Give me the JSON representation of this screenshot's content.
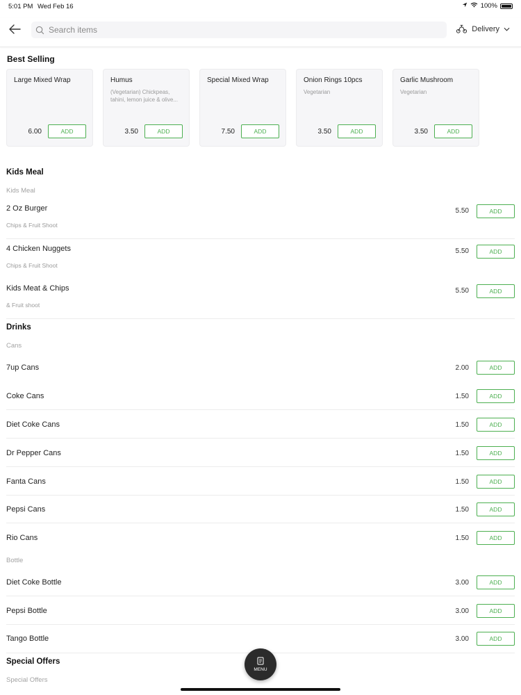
{
  "status": {
    "time": "5:01 PM",
    "date": "Wed Feb 16",
    "battery": "100%"
  },
  "header": {
    "search_placeholder": "Search items",
    "delivery_label": "Delivery"
  },
  "best_selling": {
    "title": "Best Selling",
    "items": [
      {
        "name": "Large Mixed Wrap",
        "desc": "",
        "price": "6.00",
        "add": "ADD"
      },
      {
        "name": "Humus",
        "desc": "(Vegetarian) Chickpeas, tahini, lemon juice & olive...",
        "price": "3.50",
        "add": "ADD"
      },
      {
        "name": "Special Mixed Wrap",
        "desc": "",
        "price": "7.50",
        "add": "ADD"
      },
      {
        "name": "Onion Rings 10pcs",
        "desc": "Vegetarian",
        "price": "3.50",
        "add": "ADD"
      },
      {
        "name": "Garlic Mushroom",
        "desc": "Vegetarian",
        "price": "3.50",
        "add": "ADD"
      }
    ]
  },
  "kids_meal": {
    "title": "Kids Meal",
    "subtitle": "Kids Meal",
    "items": [
      {
        "name": "2 Oz Burger",
        "desc": "Chips & Fruit Shoot",
        "price": "5.50",
        "add": "ADD"
      },
      {
        "name": "4 Chicken Nuggets",
        "desc": "Chips & Fruit Shoot",
        "price": "5.50",
        "add": "ADD"
      },
      {
        "name": "Kids Meat & Chips",
        "desc": "& Fruit shoot",
        "price": "5.50",
        "add": "ADD"
      }
    ]
  },
  "drinks": {
    "title": "Drinks",
    "cans_subtitle": "Cans",
    "cans": [
      {
        "name": "7up Cans",
        "price": "2.00",
        "add": "ADD"
      },
      {
        "name": "Coke Cans",
        "price": "1.50",
        "add": "ADD"
      },
      {
        "name": "Diet Coke Cans",
        "price": "1.50",
        "add": "ADD"
      },
      {
        "name": "Dr Pepper Cans",
        "price": "1.50",
        "add": "ADD"
      },
      {
        "name": "Fanta Cans",
        "price": "1.50",
        "add": "ADD"
      },
      {
        "name": "Pepsi Cans",
        "price": "1.50",
        "add": "ADD"
      },
      {
        "name": "Rio Cans",
        "price": "1.50",
        "add": "ADD"
      }
    ],
    "bottle_subtitle": "Bottle",
    "bottles": [
      {
        "name": "Diet Coke Bottle",
        "price": "3.00",
        "add": "ADD"
      },
      {
        "name": "Pepsi Bottle",
        "price": "3.00",
        "add": "ADD"
      },
      {
        "name": "Tango Bottle",
        "price": "3.00",
        "add": "ADD"
      }
    ]
  },
  "special_offers": {
    "title": "Special Offers",
    "subtitle": "Special Offers"
  },
  "menu_fab": {
    "label": "MENU"
  },
  "colors": {
    "accent": "#4caf50",
    "fab": "#2b2b2b"
  }
}
